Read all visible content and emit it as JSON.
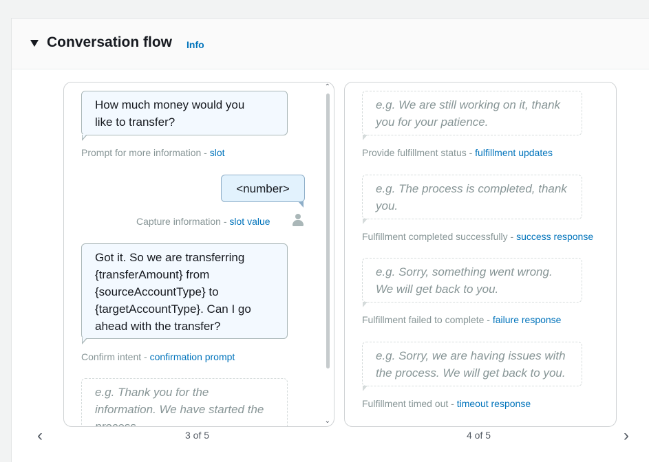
{
  "header": {
    "title": "Conversation flow",
    "info_label": "Info"
  },
  "card3": {
    "page_label": "3 of 5",
    "bubble_slot_prompt": [
      "How much money would you",
      "like to transfer?"
    ],
    "caption_slot_prefix": "Prompt for more information - ",
    "caption_slot_link": "slot",
    "user_bubble": "<number>",
    "caption_capture_prefix": "Capture information - ",
    "caption_capture_link": "slot value",
    "bubble_confirm": [
      "Got it. So we are transferring",
      "{transferAmount} from",
      "{sourceAccountType} to",
      "{targetAccountType}. Can I go",
      "ahead with the transfer?"
    ],
    "caption_confirm_prefix": "Confirm intent - ",
    "caption_confirm_link": "confirmation prompt",
    "bubble_placeholder": [
      "e.g. Thank you for the",
      "information. We have started the",
      "process."
    ]
  },
  "card4": {
    "page_label": "4 of 5",
    "items": [
      {
        "placeholder": [
          "e.g. We are still working on it, thank",
          "you for your patience."
        ],
        "caption_prefix": "Provide fulfillment status - ",
        "caption_link": "fulfillment updates"
      },
      {
        "placeholder": [
          "e.g. The process is completed, thank",
          "you."
        ],
        "caption_prefix": "Fulfillment completed successfully - ",
        "caption_link": "success response"
      },
      {
        "placeholder": [
          "e.g. Sorry, something went wrong.",
          "We will get back to you."
        ],
        "caption_prefix": "Fulfillment failed to complete - ",
        "caption_link": "failure response"
      },
      {
        "placeholder": [
          "e.g. Sorry, we are having issues with",
          "the process. We will get back to you."
        ],
        "caption_prefix": "Fulfillment timed out - ",
        "caption_link": "timeout response"
      }
    ]
  },
  "nav": {
    "prev_icon": "chevron-left-icon",
    "next_icon": "chevron-right-icon"
  },
  "colors": {
    "link": "#0073bb",
    "caption": "#879596",
    "bot_bubble_bg": "#f3f9ff",
    "user_bubble_bg": "#e2f2fd"
  }
}
